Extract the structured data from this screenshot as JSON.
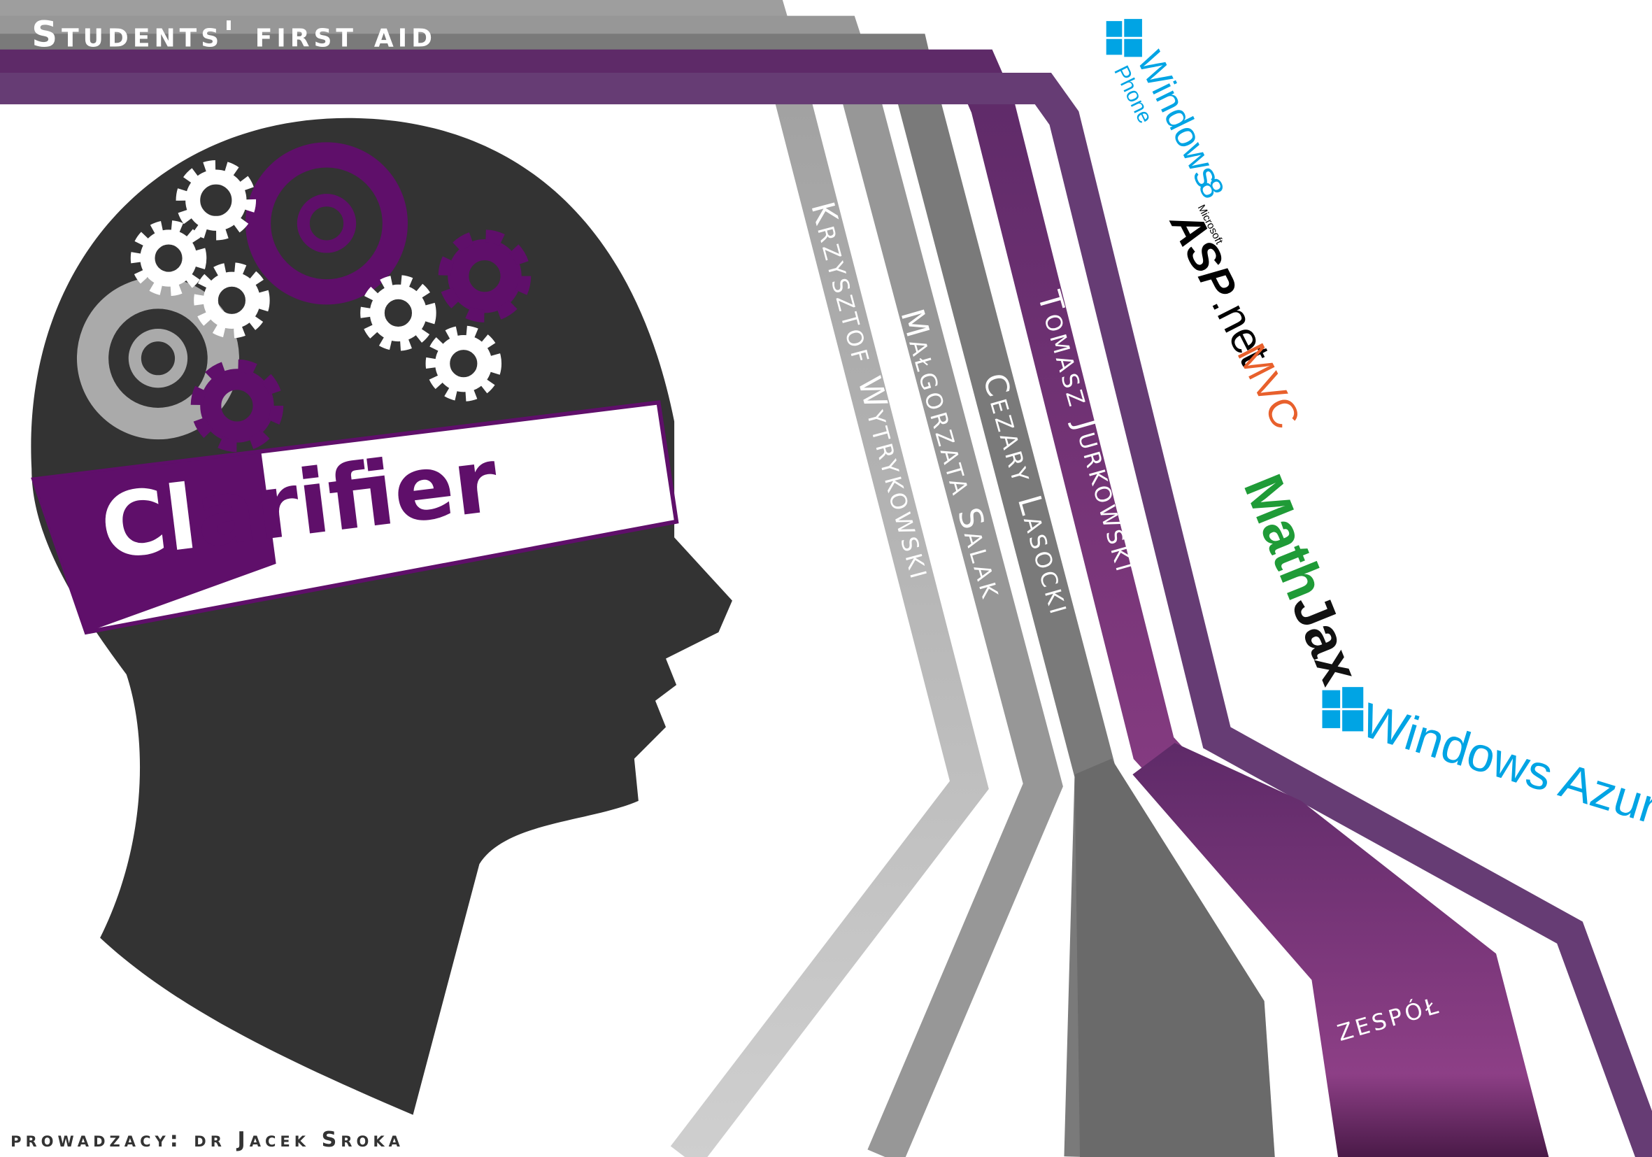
{
  "header": {
    "title": "Students' first aid"
  },
  "logo": {
    "text_a": "Cl",
    "text_b": "arifier"
  },
  "team": {
    "members": [
      "Krzysztof Wytrykowski",
      "Małgorzata Salak",
      "Cezary Lasocki",
      "Tomasz Jurkowski"
    ],
    "label": "zespół"
  },
  "footer": {
    "supervisor": "prowadzacy: dr Jacek Sroka"
  },
  "technologies": {
    "windows_phone": {
      "name": "Windows",
      "sub": "Phone",
      "version": "8"
    },
    "aspnet": {
      "maker": "Microsoft",
      "name_a": "ASP",
      "name_b": ".net",
      "suffix": "MVC"
    },
    "mathjax": {
      "name_a": "Math",
      "name_b": "Jax"
    },
    "azure": {
      "name": "Windows Azure"
    }
  },
  "colors": {
    "purple": "#5f0f6a",
    "dark": "#333333",
    "azure": "#00a4e4",
    "mathjax_green": "#1f9b37",
    "mvc_orange": "#e8602c"
  }
}
